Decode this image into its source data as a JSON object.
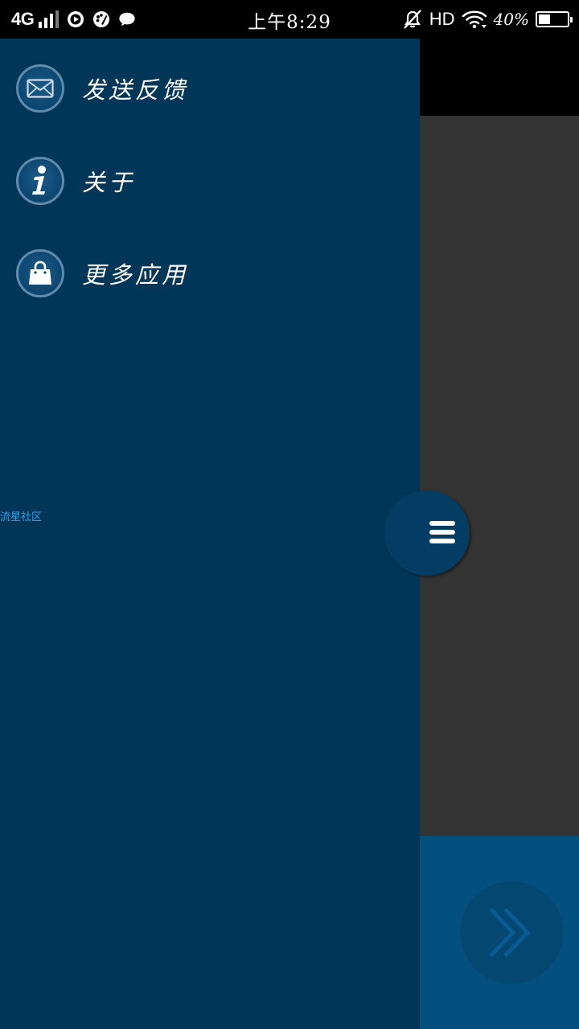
{
  "status_bar": {
    "network": "4G",
    "time": "上午8:29",
    "hd": "HD",
    "battery_text": "40%",
    "battery_level": 0.4
  },
  "drawer": {
    "items": [
      {
        "label": "发送反馈",
        "icon": "mail-icon"
      },
      {
        "label": "关于",
        "icon": "info-icon"
      },
      {
        "label": "更多应用",
        "icon": "shopping-bag-icon"
      }
    ],
    "community_link": "流星社区"
  },
  "colors": {
    "drawer_bg": "#013658",
    "content_bg": "#333333",
    "bottom_bar_bg": "#03507f",
    "link": "#2e9ee6"
  }
}
